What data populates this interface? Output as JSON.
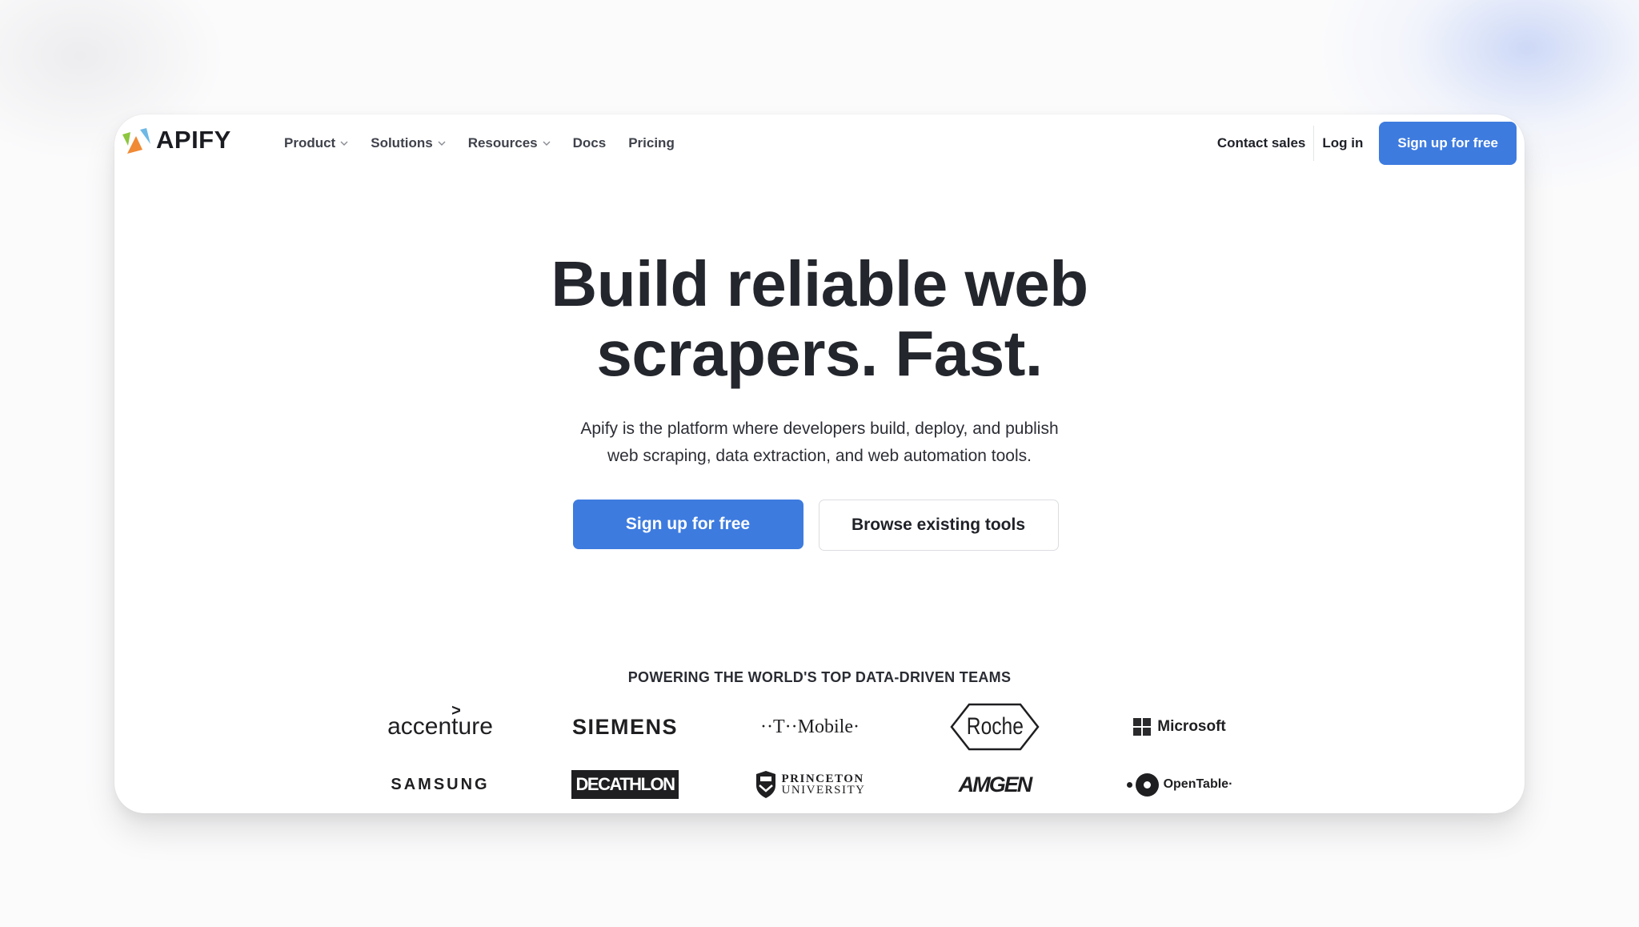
{
  "brand": {
    "name": "APIFY",
    "logo_colors": {
      "green": "#8dc63f",
      "orange": "#f08a35",
      "blue": "#6fb8e6"
    }
  },
  "nav": {
    "items": [
      {
        "label": "Product",
        "has_dropdown": true
      },
      {
        "label": "Solutions",
        "has_dropdown": true
      },
      {
        "label": "Resources",
        "has_dropdown": true
      },
      {
        "label": "Docs",
        "has_dropdown": false
      },
      {
        "label": "Pricing",
        "has_dropdown": false
      }
    ],
    "contact_sales": "Contact sales",
    "log_in": "Log in",
    "signup": "Sign up for free"
  },
  "hero": {
    "title_line1": "Build reliable web",
    "title_line2": "scrapers. Fast.",
    "subtitle_line1": "Apify is the platform where developers build, deploy, and publish",
    "subtitle_line2": "web scraping, data extraction, and web automation tools.",
    "primary_cta": "Sign up for free",
    "secondary_cta": "Browse existing tools"
  },
  "customers": {
    "heading": "POWERING THE WORLD'S TOP DATA-DRIVEN TEAMS",
    "row1": [
      "accenture",
      "SIEMENS",
      "T-Mobile",
      "Roche",
      "Microsoft"
    ],
    "row2": [
      "SAMSUNG",
      "DECATHLON",
      "PRINCETON UNIVERSITY",
      "AMGEN",
      "OpenTable"
    ],
    "logo_text": {
      "accenture": "accenture",
      "accenture_mark": ">",
      "siemens": "SIEMENS",
      "tmobile": "··T··Mobile·",
      "roche": "Roche",
      "microsoft": "Microsoft",
      "samsung": "SAMSUNG",
      "decathlon": "DECATHLON",
      "princeton_1": "PRINCETON",
      "princeton_2": "UNIVERSITY",
      "amgen": "AMGEN",
      "opentable": "OpenTable·"
    }
  },
  "colors": {
    "primary": "#3d7bdf",
    "text": "#24262d",
    "background": "#fbfbfc",
    "card": "#ffffff"
  }
}
